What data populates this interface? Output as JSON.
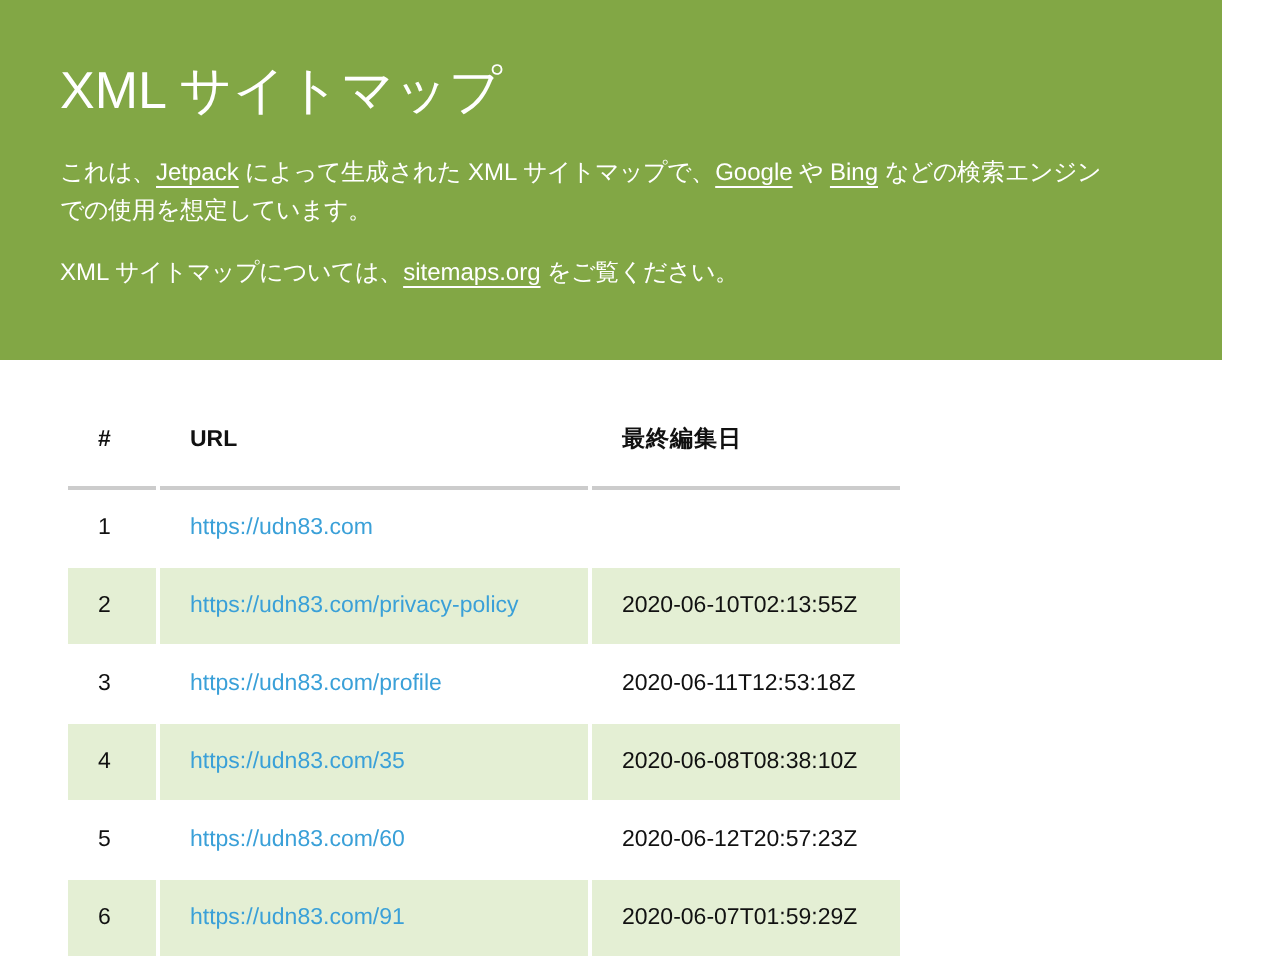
{
  "header": {
    "title": "XML サイトマップ",
    "paragraphs": [
      [
        {
          "text": "これは、",
          "link": false
        },
        {
          "text": "Jetpack",
          "link": true
        },
        {
          "text": " によって生成された XML サイトマップで、",
          "link": false
        },
        {
          "text": "Google",
          "link": true
        },
        {
          "text": " や ",
          "link": false
        },
        {
          "text": "Bing",
          "link": true
        },
        {
          "text": " などの検索エンジン",
          "link": false
        },
        {
          "text": "での使用を想定しています。",
          "link": false
        }
      ],
      [
        {
          "text": "XML サイトマップについては、",
          "link": false
        },
        {
          "text": "sitemaps.org",
          "link": true
        },
        {
          "text": " をご覧ください。",
          "link": false
        }
      ]
    ]
  },
  "table": {
    "columns": [
      "#",
      "URL",
      "最終編集日"
    ],
    "rows": [
      [
        "1",
        "https://udn83.com",
        ""
      ],
      [
        "2",
        "https://udn83.com/privacy-policy",
        "2020-06-10T02:13:55Z"
      ],
      [
        "3",
        "https://udn83.com/profile",
        "2020-06-11T12:53:18Z"
      ],
      [
        "4",
        "https://udn83.com/35",
        "2020-06-08T08:38:10Z"
      ],
      [
        "5",
        "https://udn83.com/60",
        "2020-06-12T20:57:23Z"
      ],
      [
        "6",
        "https://udn83.com/91",
        "2020-06-07T01:59:29Z"
      ]
    ]
  }
}
